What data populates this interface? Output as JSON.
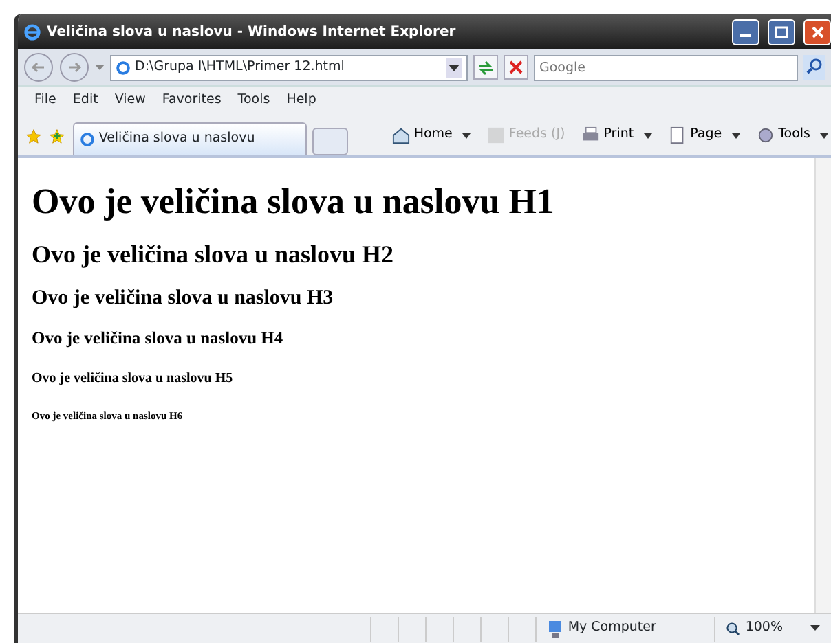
{
  "window": {
    "title": "Veličina slova u naslovu - Windows Internet Explorer"
  },
  "address_bar": {
    "value": "D:\\Grupa I\\HTML\\Primer 12.html"
  },
  "search": {
    "placeholder": "Google"
  },
  "menu": [
    "File",
    "Edit",
    "View",
    "Favorites",
    "Tools",
    "Help"
  ],
  "tabs": [
    {
      "label": "Veličina slova u naslovu",
      "selected": true
    }
  ],
  "command_bar": [
    {
      "label": "Home",
      "kind": "home",
      "disabled": false
    },
    {
      "label": "Feeds (J)",
      "kind": "feeds",
      "disabled": true
    },
    {
      "label": "Print",
      "kind": "print",
      "disabled": false
    },
    {
      "label": "Page",
      "kind": "page",
      "disabled": false
    },
    {
      "label": "Tools",
      "kind": "tools",
      "disabled": false
    }
  ],
  "content": {
    "headings": [
      {
        "kind": "h1",
        "text": "Ovo je veličina slova u naslovu H1"
      },
      {
        "kind": "h2",
        "text": "Ovo je veličina slova u naslovu H2"
      },
      {
        "kind": "h3",
        "text": "Ovo je veličina slova u naslovu H3"
      },
      {
        "kind": "h4",
        "text": "Ovo je veličina slova u naslovu H4"
      },
      {
        "kind": "h5",
        "text": "Ovo je veličina slova u naslovu H5"
      },
      {
        "kind": "h6",
        "text": "Ovo je veličina slova u naslovu H6"
      }
    ]
  },
  "status_bar": {
    "zone": "My Computer",
    "zoom": "100%"
  }
}
